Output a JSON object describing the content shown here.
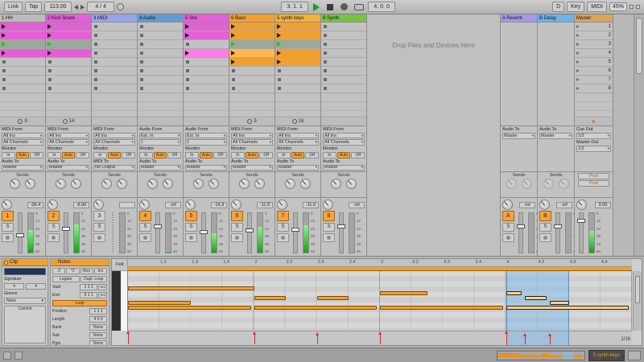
{
  "transport": {
    "link": "Link",
    "tap": "Tap",
    "tempo": "113.00",
    "sig": "4 / 4",
    "pos": "3. 1. 1",
    "loop_len": "4. 0. 0",
    "d": "D",
    "key": "Key",
    "midi": "MIDI",
    "cpu": "45%"
  },
  "session": {
    "drop_text": "Drop Files and Devices Here",
    "monitor_label": "Monitor",
    "monitor": [
      "In",
      "Auto",
      "Off"
    ],
    "sends_label": "Sends",
    "db_scale": [
      "0",
      "12",
      "24",
      "36",
      "48",
      "60"
    ],
    "tracks": [
      {
        "name": "1 HH",
        "color": "#bcbcbc",
        "status": "9",
        "vol": "-36.4",
        "num": "1",
        "num_on": true,
        "solo": "S",
        "meter": 0.58,
        "fader": 0.5,
        "clips": [
          {
            "t": "clip",
            "c": "#e55fd6"
          },
          {
            "t": "clip",
            "c": "#e55fd6"
          },
          {
            "t": "play"
          },
          {
            "t": "clip",
            "c": "#e55fd6"
          },
          {
            "t": "empty"
          },
          {
            "t": "empty"
          },
          {
            "t": "empty"
          },
          {
            "t": "empty"
          }
        ],
        "io": {
          "from": "MIDI From",
          "in1": "All Ins",
          "in2": "All Channels",
          "mon": "Auto",
          "to": "Audio To",
          "out": "Master"
        }
      },
      {
        "name": "2 Kick Snare",
        "color": "#e55fd6",
        "status": "14",
        "vol": "-8.90",
        "num": "2",
        "num_on": true,
        "solo": "S",
        "meter": 0.72,
        "fader": 0.36,
        "clips": [
          {
            "t": "clip",
            "c": "#e55fd6"
          },
          {
            "t": "clip",
            "c": "#e55fd6"
          },
          {
            "t": "play"
          },
          {
            "t": "clip",
            "c": "#e55fd6"
          },
          {
            "t": "empty"
          },
          {
            "t": "empty"
          },
          {
            "t": "empty"
          },
          {
            "t": "empty"
          }
        ],
        "io": {
          "from": "MIDI From",
          "in1": "All Ins",
          "in2": "All Channels",
          "mon": "Auto",
          "to": "Audio To",
          "out": "Master"
        }
      },
      {
        "name": "3 MIDI",
        "color": "#9aa4e8",
        "status": "",
        "vol": "",
        "num": "3",
        "num_on": false,
        "solo": "S",
        "meter": 0,
        "fader": 0.5,
        "no_audio": true,
        "clips": [
          {
            "t": "empty"
          },
          {
            "t": "empty"
          },
          {
            "t": "empty"
          },
          {
            "t": "empty"
          },
          {
            "t": "empty"
          },
          {
            "t": "empty"
          },
          {
            "t": "empty"
          },
          {
            "t": "empty"
          }
        ],
        "io": {
          "from": "MIDI From",
          "in1": "All Ins",
          "in2": "All Channels",
          "mon": "Auto",
          "to": "MIDI To",
          "out": "No Output"
        }
      },
      {
        "name": "4 Audio",
        "color": "#5f9dd8",
        "status": "",
        "vol": "-inf",
        "num": "4",
        "num_on": true,
        "solo": "S",
        "meter": 0.04,
        "fader": 0.3,
        "clips": [
          {
            "t": "empty"
          },
          {
            "t": "empty"
          },
          {
            "t": "empty"
          },
          {
            "t": "empty"
          },
          {
            "t": "empty"
          },
          {
            "t": "empty"
          },
          {
            "t": "empty"
          },
          {
            "t": "empty"
          }
        ],
        "io": {
          "from": "Audio From",
          "in1": "Ext. In",
          "in2": "1",
          "mon": "Auto",
          "to": "Audio To",
          "out": "Master"
        }
      },
      {
        "name": "5 Vox",
        "color": "#e55fd6",
        "status": "",
        "vol": "-16.3",
        "num": "5",
        "num_on": true,
        "solo": "S",
        "meter": 0.48,
        "fader": 0.44,
        "clips": [
          {
            "t": "clip",
            "c": "#e55fd6"
          },
          {
            "t": "clip",
            "c": "#e55fd6"
          },
          {
            "t": "empty"
          },
          {
            "t": "clip",
            "c": "#ff7ce6"
          },
          {
            "t": "empty"
          },
          {
            "t": "empty"
          },
          {
            "t": "empty"
          },
          {
            "t": "empty"
          }
        ],
        "io": {
          "from": "Audio From",
          "in1": "Ext. In",
          "in2": "1",
          "mon": "Auto",
          "to": "Audio To",
          "out": "Master"
        }
      },
      {
        "name": "6 Bass",
        "color": "#f0a030",
        "status": "9",
        "vol": "-11.9",
        "num": "6",
        "num_on": true,
        "solo": "S",
        "meter": 0.66,
        "fader": 0.4,
        "clips": [
          {
            "t": "clip",
            "c": "#f0a030"
          },
          {
            "t": "clip",
            "c": "#f0a030"
          },
          {
            "t": "play"
          },
          {
            "t": "clip",
            "c": "#ffb850"
          },
          {
            "t": "clip",
            "c": "#f0a030"
          },
          {
            "t": "empty"
          },
          {
            "t": "empty"
          },
          {
            "t": "empty"
          }
        ],
        "io": {
          "from": "MIDI From",
          "in1": "All Ins",
          "in2": "All Channels",
          "mon": "Auto",
          "to": "Audio To",
          "out": "Master"
        }
      },
      {
        "name": "5 synth keys",
        "color": "#f2b03c",
        "status": "16",
        "vol": "-11.0",
        "num": "7",
        "num_on": true,
        "solo": "S",
        "meter": 0.7,
        "fader": 0.38,
        "clips": [
          {
            "t": "clip",
            "c": "#f0a030"
          },
          {
            "t": "clip",
            "c": "#f0a030"
          },
          {
            "t": "play"
          },
          {
            "t": "clip",
            "c": "#f0a030"
          },
          {
            "t": "clip",
            "c": "#f0a030"
          },
          {
            "t": "empty"
          },
          {
            "t": "empty"
          },
          {
            "t": "empty"
          }
        ],
        "io": {
          "from": "MIDI From",
          "in1": "All Ins",
          "in2": "All Channels",
          "mon": "Auto",
          "to": "Audio To",
          "out": "Master"
        }
      },
      {
        "name": "6 Synth",
        "color": "#79c143",
        "status": "",
        "vol": "-inf",
        "num": "8",
        "num_on": true,
        "solo": "S",
        "meter": 0,
        "fader": 0.3,
        "clips": [
          {
            "t": "empty"
          },
          {
            "t": "empty"
          },
          {
            "t": "empty"
          },
          {
            "t": "empty"
          },
          {
            "t": "empty"
          },
          {
            "t": "empty"
          },
          {
            "t": "empty"
          },
          {
            "t": "empty"
          }
        ],
        "io": {
          "from": "MIDI From",
          "in1": "All Ins",
          "in2": "All Channels",
          "mon": "Auto",
          "to": "Audio To",
          "out": "Master"
        }
      }
    ],
    "returns": [
      {
        "name": "A Reverb",
        "color": "#a898e8",
        "vol": "-inf",
        "num": "A",
        "solo": "S",
        "meter": 0,
        "fader": 0.3,
        "to_label": "Audio To",
        "out": "Master"
      },
      {
        "name": "B Delay",
        "color": "#6fb3e8",
        "vol": "-inf",
        "num": "B",
        "solo": "S",
        "meter": 0,
        "fader": 0.3,
        "to_label": "Audio To",
        "out": "Master"
      }
    ],
    "master": {
      "name": "Master",
      "color": "#d9a65e",
      "scenes": [
        "1",
        "2",
        "3",
        "4",
        "5",
        "6",
        "7",
        "8"
      ],
      "cue_label": "Cue Out",
      "cue": "1/2",
      "out_label": "Master Out",
      "out": "1/2",
      "posts": [
        "Post",
        "Post"
      ],
      "vol": "0.00",
      "meter": 0.55,
      "fader": 0.18
    }
  },
  "clip_panel": {
    "title": "Clip",
    "name": "",
    "sig_label": "Signature",
    "sig_num": "4",
    "sig_den": "4",
    "groove_label": "Groove",
    "groove": "None",
    "commit": "Commit"
  },
  "notes_panel": {
    "title": "Notes",
    "half": ":2",
    "dbl": "*2",
    "rev": "Rev",
    "inv": "Inv",
    "legato": "Legato",
    "dupl": "Dupl. Loop",
    "start_label": "Start",
    "start": "1 1 1",
    "end_label": "End",
    "end": "5 1 1",
    "set": "Set",
    "loop_label": "Loop",
    "pos_label": "Position",
    "pos": "1 1 1",
    "len_label": "Length",
    "len": "4 0 0",
    "bank_label": "Bank",
    "sub_label": "Sub",
    "pgm_label": "Pgm",
    "none": "None"
  },
  "piano_roll": {
    "fold": "Fold",
    "grid_label": "1/16",
    "beats": 16,
    "rows": 12,
    "ruler": [
      "1.2",
      "1.3",
      "1.4",
      "2",
      "2.2",
      "2.3",
      "2.4",
      "3",
      "3.2",
      "3.3",
      "3.4",
      "4",
      "4.2",
      "4.3",
      "4.4"
    ],
    "selection": {
      "start": 12,
      "end": 14
    },
    "notes": [
      {
        "start": 0,
        "dur": 4,
        "row": 3
      },
      {
        "start": 0,
        "dur": 2,
        "row": 6
      },
      {
        "start": 0,
        "dur": 3.9,
        "row": 7
      },
      {
        "start": 4,
        "dur": 3.9,
        "row": 7
      },
      {
        "start": 8,
        "dur": 3.9,
        "row": 7
      },
      {
        "start": 12,
        "dur": 3.9,
        "row": 7,
        "sel": true
      },
      {
        "start": 4,
        "dur": 1,
        "row": 5
      },
      {
        "start": 6,
        "dur": 1,
        "row": 5
      },
      {
        "start": 8,
        "dur": 1.5,
        "row": 4
      },
      {
        "start": 12,
        "dur": 0.5,
        "row": 4,
        "sel": true
      },
      {
        "start": 12.6,
        "dur": 0.7,
        "row": 5,
        "sel": true
      },
      {
        "start": 13.4,
        "dur": 0.6,
        "row": 6,
        "sel": true
      }
    ],
    "velocities": [
      {
        "beat": 0,
        "v": 0.9
      },
      {
        "beat": 4,
        "v": 0.85
      },
      {
        "beat": 6,
        "v": 0.8
      },
      {
        "beat": 8,
        "v": 0.85
      },
      {
        "beat": 12,
        "v": 0.9
      },
      {
        "beat": 12.6,
        "v": 0.7
      },
      {
        "beat": 13.4,
        "v": 0.75
      }
    ]
  },
  "status": {
    "clip_name": "5 synth keys"
  }
}
